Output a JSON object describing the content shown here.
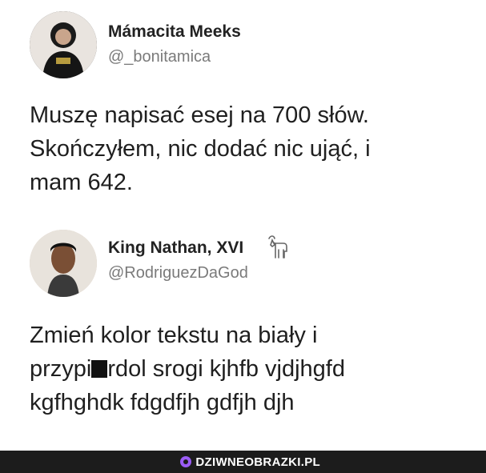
{
  "tweets": [
    {
      "name": "Mámacita Meeks",
      "handle": "@_bonitamica",
      "text_lines": [
        "Muszę napisać esej na 700 słów.",
        "Skończyłem, nic dodać nic ująć, i",
        "mam 642."
      ]
    },
    {
      "name": "King Nathan, XVI",
      "handle": "@RodriguezDaGod",
      "text_line1": "Zmień kolor tekstu na biały i",
      "text_line2_before": "przypi",
      "text_line2_after": "rdol srogi kjhfb vjdjhgfd",
      "text_line3": "kgfhghdk fdgdfjh gdfjh djh"
    }
  ],
  "footer": {
    "brand": "DZIWNEOBRAZKI.PL"
  },
  "colors": {
    "brand_icon": "#9b5cf6",
    "footer_bg": "#1c1c1c"
  }
}
